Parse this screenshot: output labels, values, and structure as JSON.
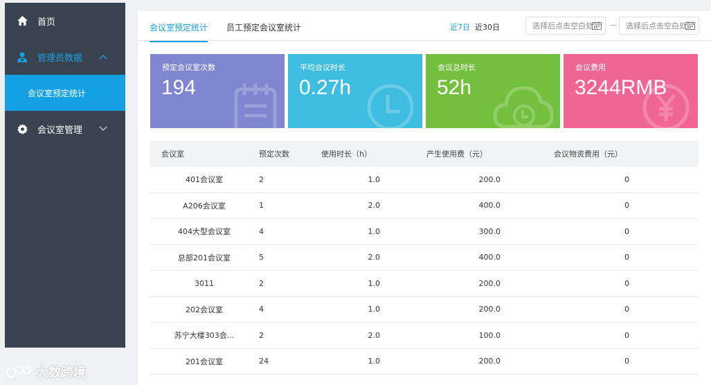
{
  "sidebar": {
    "home": "首页",
    "admin_data": "管理员数据",
    "sub_item": "会议室预定统计",
    "room_manage": "会议室管理"
  },
  "watermark": "大数跨境",
  "tabs": [
    "会议室预定统计",
    "员工预定会议室统计"
  ],
  "ranges": [
    "近7日",
    "近30日"
  ],
  "date_placeholder_start": "选择后点击空白处",
  "date_placeholder_end": "选择后点击空白处",
  "cards": [
    {
      "label": "预定会议室次数",
      "value": "194",
      "color": "#7f86cf",
      "icon": "notepad-icon"
    },
    {
      "label": "平均会议时长",
      "value": "0.27h",
      "color": "#3fbde0",
      "icon": "clock-icon"
    },
    {
      "label": "会议总时长",
      "value": "52h",
      "color": "#72c03e",
      "icon": "cloud-clock-icon"
    },
    {
      "label": "会议费用",
      "value": "3244RMB",
      "color": "#ef6593",
      "icon": "yen-icon"
    }
  ],
  "table": {
    "headers": [
      "会议室",
      "预定次数",
      "使用时长（h）",
      "产生使用费（元）",
      "会议物资费用（元）"
    ],
    "rows": [
      [
        "401会议室",
        "2",
        "1.0",
        "200.0",
        "0"
      ],
      [
        "A206会议室",
        "1",
        "2.0",
        "400.0",
        "0"
      ],
      [
        "404大型会议室",
        "4",
        "1.0",
        "300.0",
        "0"
      ],
      [
        "总部201会议室",
        "5",
        "2.0",
        "400.0",
        "0"
      ],
      [
        "3011",
        "2",
        "1.0",
        "200.0",
        "0"
      ],
      [
        "202会议室",
        "4",
        "1.0",
        "200.0",
        "0"
      ],
      [
        "苏宁大楼303会...",
        "2",
        "2.0",
        "100.0",
        "0"
      ],
      [
        "201会议室",
        "24",
        "1.0",
        "200.0",
        "0"
      ]
    ]
  }
}
